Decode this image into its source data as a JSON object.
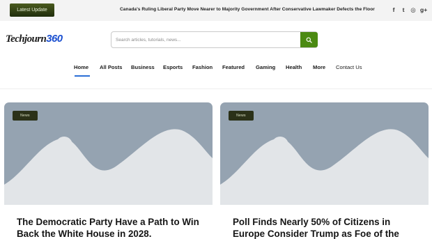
{
  "topbar": {
    "latest_label": "Latest Update",
    "headline": "Canada's Ruling Liberal Party Move Nearer to Majority Government After Conservative Lawmaker Defects the Floor",
    "socials": [
      {
        "icon": "facebook-icon",
        "glyph": "f"
      },
      {
        "icon": "twitter-icon",
        "glyph": "t"
      },
      {
        "icon": "instagram-icon",
        "glyph": "◎"
      },
      {
        "icon": "google-plus-icon",
        "glyph": "g+"
      }
    ]
  },
  "logo": {
    "part1": "Techjourn",
    "part2": "360"
  },
  "search": {
    "placeholder": "Search articles, tutorials, news...",
    "button_icon": "search-icon"
  },
  "nav": {
    "items": [
      {
        "label": "Home",
        "active": true
      },
      {
        "label": "All Posts"
      },
      {
        "label": "Business"
      },
      {
        "label": "Esports"
      },
      {
        "label": "Fashion"
      },
      {
        "label": "Featured"
      },
      {
        "label": "Gaming"
      },
      {
        "label": "Health"
      },
      {
        "label": "More"
      },
      {
        "label": "Contact Us"
      }
    ]
  },
  "cards": [
    {
      "badge": "News",
      "title": "The Democratic Party Have a Path to Win Back the White House in 2028."
    },
    {
      "badge": "News",
      "title": "Poll Finds Nearly 50% of Citizens in Europe Consider Trump as Foe of the"
    }
  ],
  "colors": {
    "accent_green": "#4b8a12",
    "nav_active": "#2b6fd6",
    "placeholder_bg": "#95a3b1",
    "badge_bg": "#2b3118"
  }
}
